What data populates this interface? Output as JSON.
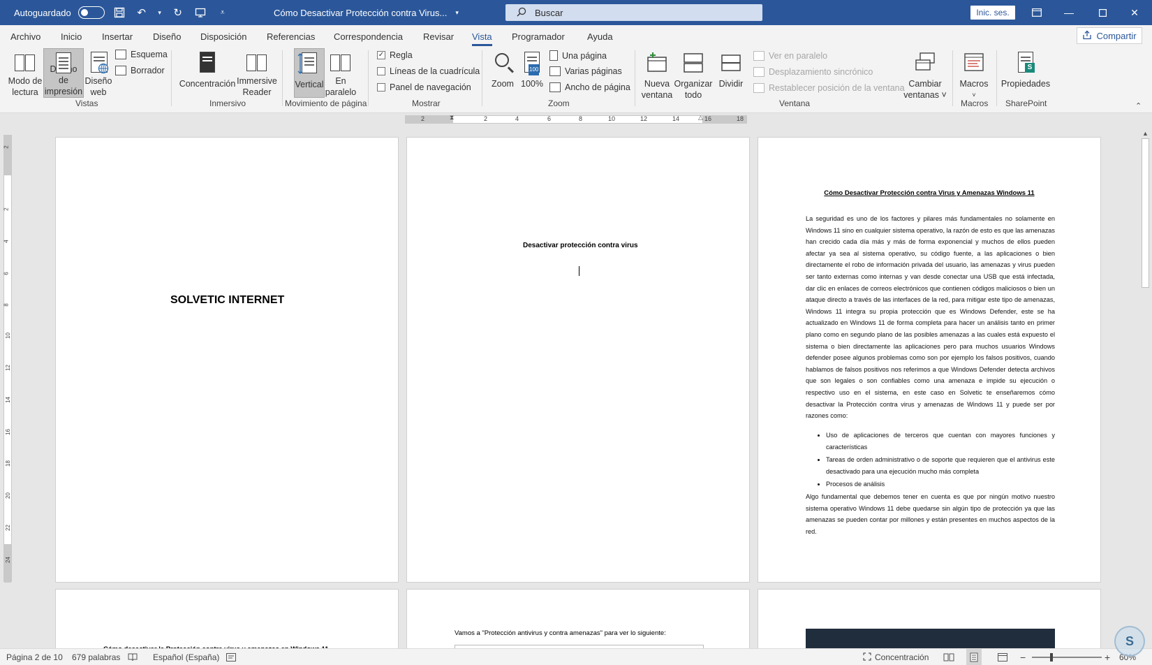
{
  "titlebar": {
    "autosave_label": "Autoguardado",
    "document_title": "Cómo Desactivar Protección contra Virus...",
    "search_placeholder": "Buscar",
    "signin_label": "Inic. ses.",
    "accent_color": "#2b579a"
  },
  "tabs": [
    {
      "label": "Archivo"
    },
    {
      "label": "Inicio"
    },
    {
      "label": "Insertar"
    },
    {
      "label": "Diseño"
    },
    {
      "label": "Disposición"
    },
    {
      "label": "Referencias"
    },
    {
      "label": "Correspondencia"
    },
    {
      "label": "Revisar"
    },
    {
      "label": "Vista",
      "active": true
    },
    {
      "label": "Programador"
    },
    {
      "label": "Ayuda"
    }
  ],
  "share_label": "Compartir",
  "ribbon": {
    "vistas": {
      "group_label": "Vistas",
      "modo_lectura": [
        "Modo de",
        "lectura"
      ],
      "diseno_impresion": [
        "Diseño de",
        "impresión"
      ],
      "diseno_web": [
        "Diseño",
        "web"
      ],
      "esquema": "Esquema",
      "borrador": "Borrador"
    },
    "inmersivo": {
      "group_label": "Inmersivo",
      "concentracion": "Concentración",
      "immersive_reader": [
        "Immersive",
        "Reader"
      ]
    },
    "movimiento": {
      "group_label": "Movimiento de página",
      "vertical": "Vertical",
      "en_paralelo": [
        "En",
        "paralelo"
      ]
    },
    "mostrar": {
      "group_label": "Mostrar",
      "regla": "Regla",
      "lineas": "Líneas de la cuadrícula",
      "panel": "Panel de navegación"
    },
    "zoom": {
      "group_label": "Zoom",
      "zoom": "Zoom",
      "cien": "100%",
      "una_pagina": "Una página",
      "varias_paginas": "Varias páginas",
      "ancho_pagina": "Ancho de página"
    },
    "ventana": {
      "group_label": "Ventana",
      "nueva": [
        "Nueva",
        "ventana"
      ],
      "organizar": [
        "Organizar",
        "todo"
      ],
      "dividir": "Dividir",
      "ver_paralelo": "Ver en paralelo",
      "desplazamiento": "Desplazamiento sincrónico",
      "restablecer": "Restablecer posición de la ventana",
      "cambiar": [
        "Cambiar",
        "ventanas ˅"
      ]
    },
    "macros": {
      "group_label": "Macros",
      "macros": "Macros"
    },
    "sharepoint": {
      "group_label": "SharePoint",
      "propiedades": "Propiedades"
    }
  },
  "ruler": {
    "h_numbers": [
      "2",
      "2",
      "4",
      "6",
      "8",
      "10",
      "12",
      "14",
      "16",
      "18"
    ],
    "v_numbers": [
      "2",
      "2",
      "4",
      "6",
      "8",
      "10",
      "12",
      "14",
      "16",
      "18",
      "20",
      "22",
      "24"
    ]
  },
  "pages": {
    "p1_title": "SOLVETIC INTERNET",
    "p2_heading": "Desactivar protección contra virus",
    "p3_title": "Cómo Desactivar Protección contra Virus y Amenazas Windows 11",
    "p3_para1": "La seguridad es uno de los factores y pilares más fundamentales no solamente en Windows 11 sino en cualquier sistema operativo, la razón de esto es que las amenazas han crecido cada día más y más de forma exponencial y muchos de ellos pueden afectar ya sea al sistema operativo, su código fuente, a las aplicaciones o bien directamente el robo  de información privada del usuario, las amenazas y virus pueden ser tanto externas como internas y van desde conectar una USB que está infectada, dar clic en enlaces de correos electrónicos que contienen códigos maliciosos o bien un ataque directo a través de las interfaces de la red, para mitigar este tipo de amenazas, Windows 11 integra su propia protección que es Windows Defender, este se ha actualizado en Windows 11 de forma completa para hacer un análisis tanto en primer plano como en segundo plano de las posibles amenazas a las cuales está expuesto el sistema o bien directamente las aplicaciones pero para muchos usuarios Windows defender posee algunos problemas como son por ejemplo los falsos positivos, cuando hablamos de falsos positivos nos referimos a que Windows Defender detecta archivos que son legales o son confiables como una amenaza e impide su ejecución o respectivo uso en el sistema, en este caso en Solvetic te enseñaremos cómo desactivar la Protección contra virus y amenazas de Windows 11 y puede ser por razones como:",
    "p3_bullets": [
      "Uso de aplicaciones de terceros que cuentan con mayores funciones y características",
      "Tareas de orden administrativo o de soporte que requieren que el antivirus este desactivado para una ejecución mucho más completa",
      "Procesos de análisis"
    ],
    "p3_para2": "Algo fundamental que debemos tener en cuenta es que por ningún motivo nuestro sistema operativo Windows 11 debe quedarse sin algún tipo de protección ya que las amenazas se pueden contar por millones y están presentes en muchos aspectos de la red.",
    "p4_heading": "Cómo desactivar la Protección contra virus y amenazas en Windows 11",
    "p5_text": "Vamos a \"Protección antivirus y contra amenazas\" para ver lo siguiente:"
  },
  "statusbar": {
    "page": "Página 2 de 10",
    "words": "679 palabras",
    "language": "Español (España)",
    "focus": "Concentración",
    "zoom_level": "60%"
  }
}
